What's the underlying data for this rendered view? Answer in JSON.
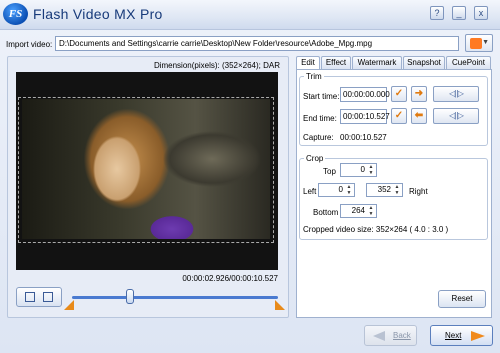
{
  "window": {
    "title": "Flash Video MX Pro",
    "logo_text": "FS",
    "buttons": [
      "?",
      "_",
      "x"
    ]
  },
  "import": {
    "label": "Import video:",
    "path": "D:\\Documents and Settings\\carrie carrie\\Desktop\\New Folder\\resource\\Adobe_Mpg.mpg"
  },
  "preview": {
    "dimension": "Dimension(pixels): (352×264); DAR",
    "time": "00:00:02.926/00:00:10.527",
    "slider_position": 0.28
  },
  "tabs": [
    "Edit",
    "Effect",
    "Watermark",
    "Snapshot",
    "CuePoint"
  ],
  "active_tab": "Edit",
  "trim": {
    "title": "Trim",
    "start_label": "Start time:",
    "start_value": "00:00:00.000",
    "end_label": "End time:",
    "end_value": "00:00:10.527",
    "capture_label": "Capture:",
    "capture_value": "00:00:10.527"
  },
  "crop": {
    "title": "Crop",
    "top_label": "Top",
    "top_value": "0",
    "left_label": "Left",
    "left_value": "0",
    "right_value": "352",
    "right_label": "Right",
    "bottom_label": "Bottom",
    "bottom_value": "264",
    "cropped_size": "Cropped video size: 352×264  ( 4.0 : 3.0 )"
  },
  "buttons": {
    "reset": "Reset",
    "back": "Back",
    "next": "Next"
  },
  "colors": {
    "accent": "#4a7ad0",
    "orange": "#e88a1a"
  }
}
